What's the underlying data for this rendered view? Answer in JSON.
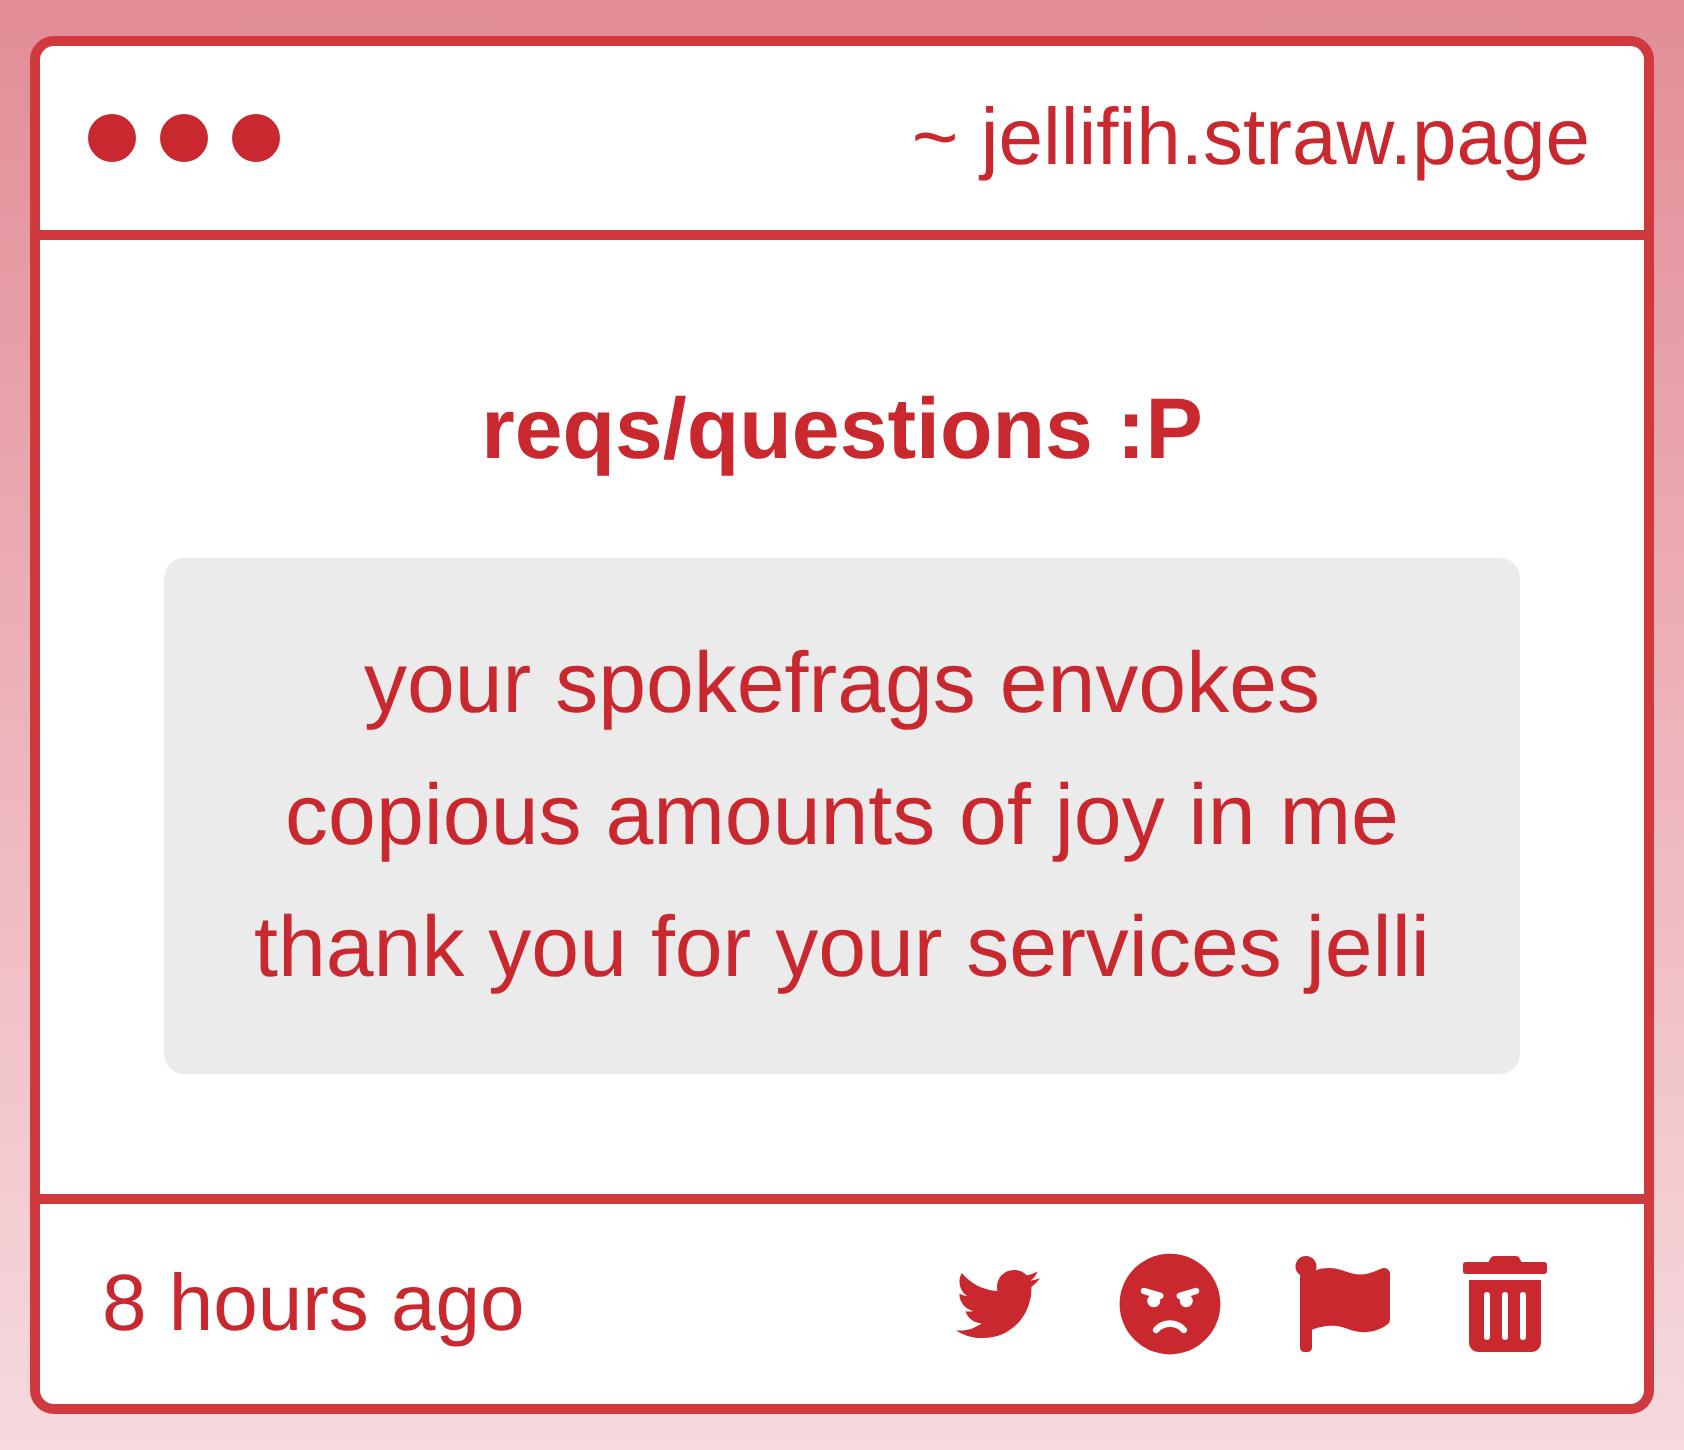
{
  "window": {
    "address": "~ jellifih.straw.page"
  },
  "title": "reqs/questions :P",
  "message": "your spokefrags envokes\ncopious amounts of joy in me\nthank you for your services jelli",
  "footer": {
    "time": "8 hours ago"
  }
}
